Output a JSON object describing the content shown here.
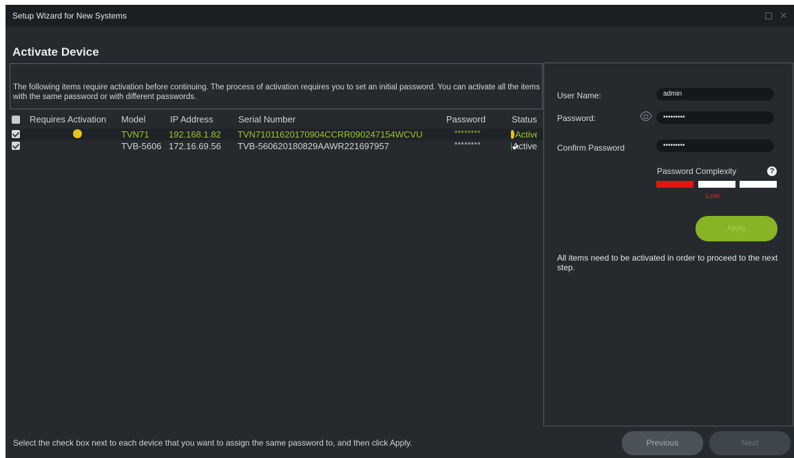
{
  "window": {
    "title": "Setup Wizard for New Systems"
  },
  "page": {
    "title": "Activate Device"
  },
  "description": "The following items require activation before continuing.  The process of activation requires you to set an initial password.  You can activate all the items with the same password or with different passwords.",
  "grid": {
    "columns": [
      "Requires Activation",
      "Model",
      "IP Address",
      "Serial Number",
      "Password",
      "Status"
    ],
    "rows": [
      {
        "model": "TVN71",
        "ip": "192.168.1.82",
        "serial": "TVN71011620170904CCRR090247154WCVU",
        "password": "********",
        "status": "Active",
        "requires_activation": true,
        "checked": true,
        "status_icon": "warning-gear-icon"
      },
      {
        "model": "TVB-5606",
        "ip": "172.16.69.56",
        "serial": "TVB-560620180829AAWR221697957",
        "password": "********",
        "status": "Active",
        "requires_activation": false,
        "checked": true,
        "status_icon": "check-circle-icon"
      }
    ]
  },
  "form": {
    "username_label": "User Name:",
    "username_value": "admin",
    "password_label": "Password:",
    "password_value": "•••••••••",
    "confirm_label": "Confirm Password",
    "confirm_value": "•••••••••",
    "complexity_label": "Password Complexity",
    "complexity_level": "Low",
    "complexity_fill": 0.33,
    "apply_label": "Apply",
    "note": "All items need to be activated in order to proceed to the next step."
  },
  "footer": {
    "hint": "Select the check box next to each device that you want to assign the same password to, and then click Apply.",
    "previous_label": "Previous",
    "next_label": "Next"
  },
  "colors": {
    "alert_text": "#9ec42a",
    "apply": "#86b424",
    "low": "#d02a2a"
  }
}
